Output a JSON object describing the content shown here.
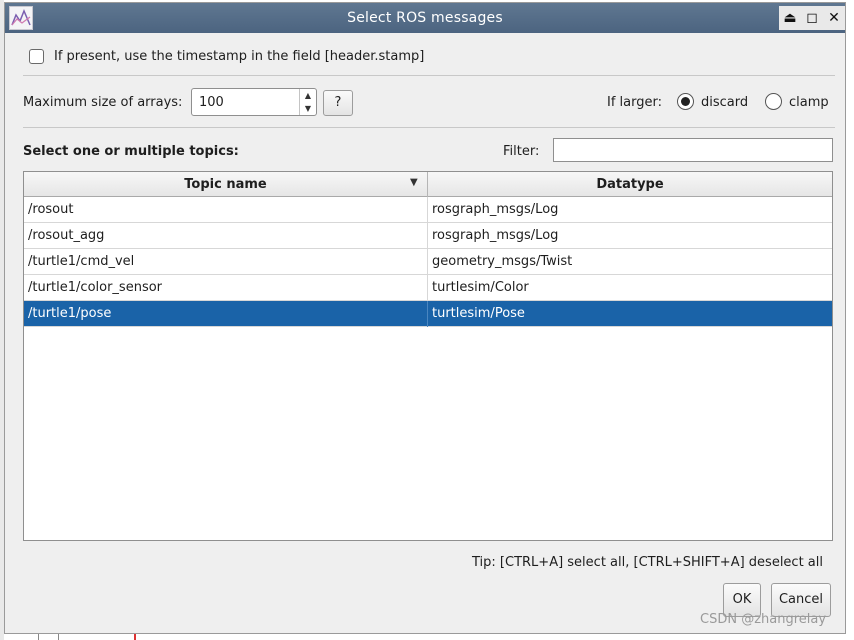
{
  "window": {
    "title": "Select ROS messages",
    "controls": [
      "⏏",
      "◻",
      "✕"
    ]
  },
  "timestamp_option": {
    "label": "If present, use the timestamp in the field [header.stamp]",
    "checked": false
  },
  "arrays": {
    "label": "Maximum size of arrays:",
    "value": "100",
    "help_label": "?"
  },
  "if_larger": {
    "label": "If larger:",
    "options": [
      {
        "label": "discard",
        "selected": true
      },
      {
        "label": "clamp",
        "selected": false
      }
    ]
  },
  "topics": {
    "label": "Select one or multiple topics:",
    "filter_label": "Filter:",
    "filter_value": "",
    "columns": [
      "Topic name",
      "Datatype"
    ],
    "rows": [
      {
        "topic": "/rosout",
        "type": "rosgraph_msgs/Log",
        "selected": false
      },
      {
        "topic": "/rosout_agg",
        "type": "rosgraph_msgs/Log",
        "selected": false
      },
      {
        "topic": "/turtle1/cmd_vel",
        "type": "geometry_msgs/Twist",
        "selected": false
      },
      {
        "topic": "/turtle1/color_sensor",
        "type": "turtlesim/Color",
        "selected": false
      },
      {
        "topic": "/turtle1/pose",
        "type": "turtlesim/Pose",
        "selected": true
      }
    ],
    "selection_color": "#1a63a8"
  },
  "tip": "Tip: [CTRL+A] select all, [CTRL+SHIFT+A] deselect all",
  "buttons": {
    "ok": "OK",
    "cancel": "Cancel"
  },
  "watermark": "CSDN @zhangrelay"
}
